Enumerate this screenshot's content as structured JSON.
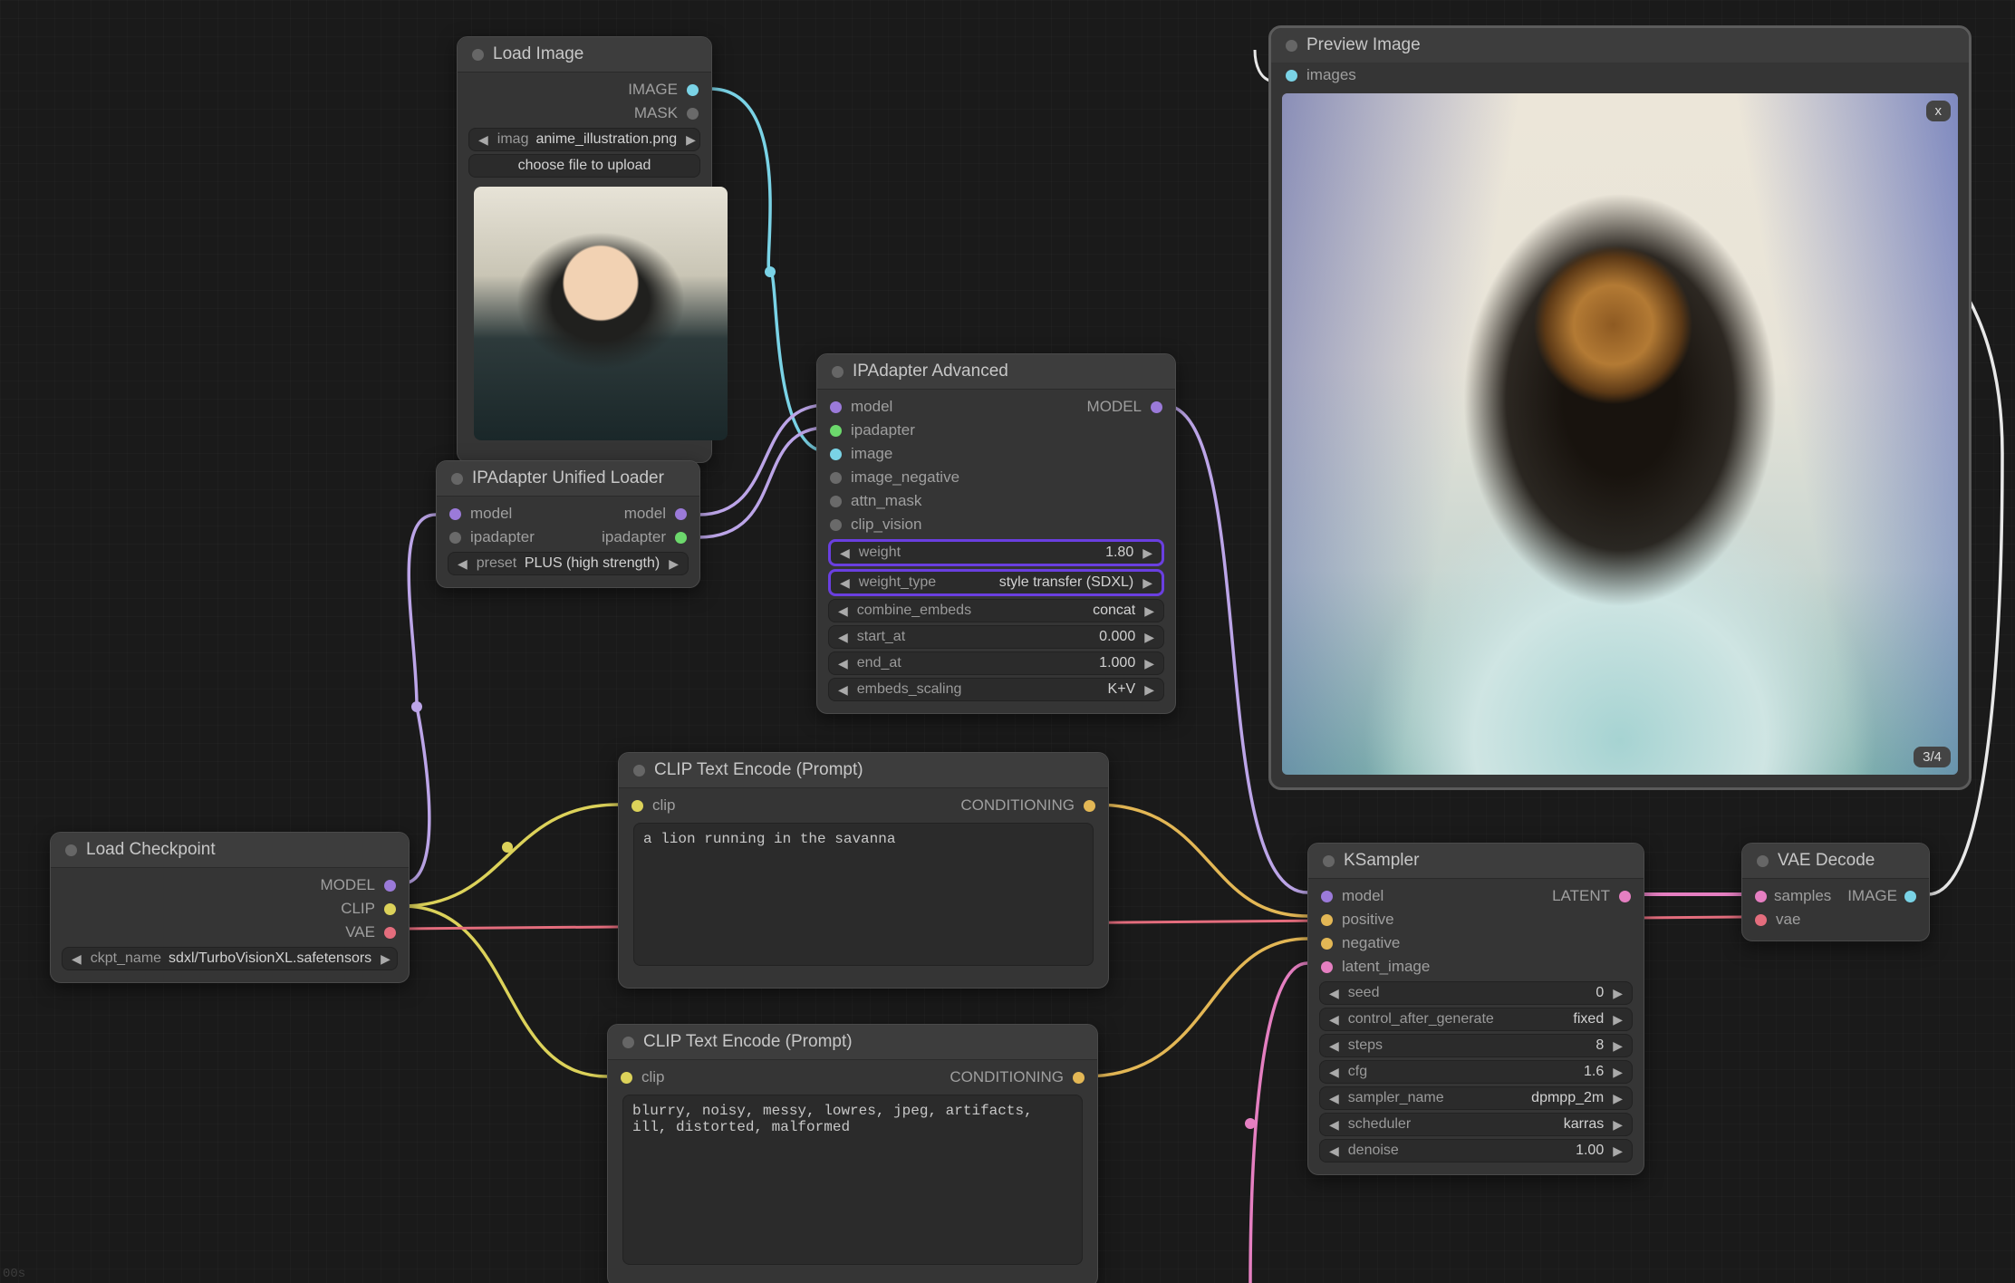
{
  "nodes": {
    "load_image": {
      "title": "Load Image",
      "outputs": {
        "image": "IMAGE",
        "mask": "MASK"
      },
      "file_field_prefix": "imag",
      "file_value": "anime_illustration.png",
      "upload_button": "choose file to upload"
    },
    "ip_unified": {
      "title": "IPAdapter Unified Loader",
      "inputs": {
        "model": "model",
        "ipadapter": "ipadapter"
      },
      "outputs": {
        "model": "model",
        "ipadapter": "ipadapter"
      },
      "preset_label": "preset",
      "preset_value": "PLUS (high strength)"
    },
    "ip_advanced": {
      "title": "IPAdapter Advanced",
      "inputs": {
        "model": "model",
        "ipadapter": "ipadapter",
        "image": "image",
        "image_negative": "image_negative",
        "attn_mask": "attn_mask",
        "clip_vision": "clip_vision"
      },
      "outputs": {
        "model": "MODEL"
      },
      "widgets": {
        "weight": {
          "label": "weight",
          "value": "1.80"
        },
        "weight_type": {
          "label": "weight_type",
          "value": "style transfer (SDXL)"
        },
        "combine_embeds": {
          "label": "combine_embeds",
          "value": "concat"
        },
        "start_at": {
          "label": "start_at",
          "value": "0.000"
        },
        "end_at": {
          "label": "end_at",
          "value": "1.000"
        },
        "embeds_scaling": {
          "label": "embeds_scaling",
          "value": "K+V"
        }
      }
    },
    "load_ckpt": {
      "title": "Load Checkpoint",
      "outputs": {
        "model": "MODEL",
        "clip": "CLIP",
        "vae": "VAE"
      },
      "ckpt_label": "ckpt_name",
      "ckpt_value": "sdxl/TurboVisionXL.safetensors"
    },
    "clip_pos": {
      "title": "CLIP Text Encode (Prompt)",
      "inputs": {
        "clip": "clip"
      },
      "outputs": {
        "conditioning": "CONDITIONING"
      },
      "text": "a lion running in the savanna"
    },
    "clip_neg": {
      "title": "CLIP Text Encode (Prompt)",
      "inputs": {
        "clip": "clip"
      },
      "outputs": {
        "conditioning": "CONDITIONING"
      },
      "text": "blurry, noisy, messy, lowres, jpeg, artifacts, ill, distorted, malformed"
    },
    "ksampler": {
      "title": "KSampler",
      "inputs": {
        "model": "model",
        "positive": "positive",
        "negative": "negative",
        "latent_image": "latent_image"
      },
      "outputs": {
        "latent": "LATENT"
      },
      "widgets": {
        "seed": {
          "label": "seed",
          "value": "0"
        },
        "control_after_generate": {
          "label": "control_after_generate",
          "value": "fixed"
        },
        "steps": {
          "label": "steps",
          "value": "8"
        },
        "cfg": {
          "label": "cfg",
          "value": "1.6"
        },
        "sampler_name": {
          "label": "sampler_name",
          "value": "dpmpp_2m"
        },
        "scheduler": {
          "label": "scheduler",
          "value": "karras"
        },
        "denoise": {
          "label": "denoise",
          "value": "1.00"
        }
      }
    },
    "vae_decode": {
      "title": "VAE Decode",
      "inputs": {
        "samples": "samples",
        "vae": "vae"
      },
      "outputs": {
        "image": "IMAGE"
      }
    },
    "preview": {
      "title": "Preview Image",
      "inputs": {
        "images": "images"
      },
      "close_x": "x",
      "page_badge": "3/4"
    }
  },
  "footer_stat": "00s",
  "wire_colors": {
    "model": "#9b7ad9",
    "ipadapter": "#bca5e8",
    "image": "#7ad3e6",
    "clip": "#dcd25a",
    "conditioning": "#e3b755",
    "vae": "#e46d7d",
    "latent": "#e57fc1"
  }
}
